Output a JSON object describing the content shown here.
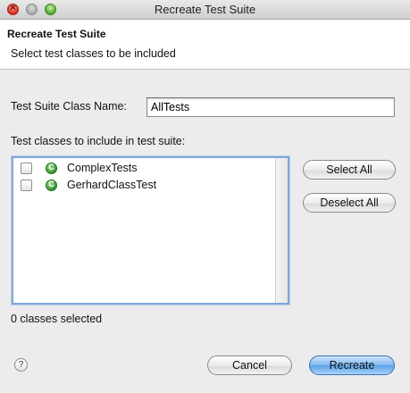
{
  "window": {
    "title": "Recreate Test Suite"
  },
  "banner": {
    "title": "Recreate Test Suite",
    "description": "Select test classes to be included"
  },
  "class_name": {
    "label": "Test Suite Class Name:",
    "value": "AllTests"
  },
  "classes": {
    "label": "Test classes to include in test suite:",
    "items": [
      {
        "label": "ComplexTests",
        "checked": false,
        "icon": "java-class-icon"
      },
      {
        "label": "GerhardClassTest",
        "checked": false,
        "icon": "java-class-icon"
      }
    ],
    "status": "0 classes selected"
  },
  "buttons": {
    "select_all": "Select All",
    "deselect_all": "Deselect All",
    "cancel": "Cancel",
    "recreate": "Recreate",
    "help": "?"
  },
  "colors": {
    "focus_ring": "#7fa7d9",
    "default_button": "#5aa0e6",
    "class_icon": "#2d8f2a"
  }
}
